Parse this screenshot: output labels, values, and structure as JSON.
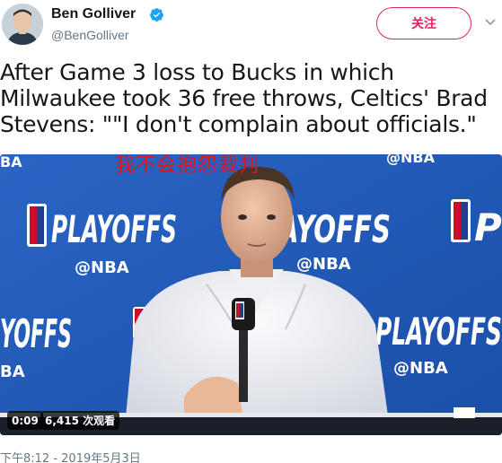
{
  "author": {
    "display_name": "Ben Golliver",
    "handle": "@BenGolliver",
    "verified": true,
    "verified_icon": "verified-badge-icon"
  },
  "follow_label": "关注",
  "tweet": {
    "text": "After Game 3 loss to Bucks in which Milwaukee took 36 free throws, Celtics' Brad Stevens: \"\"I don't complain about officials.\""
  },
  "video": {
    "overlay_caption": "我不会抱怨裁判",
    "backdrop_wordmarks": {
      "playoffs": "PLAYOFFS",
      "partial_left": "YOFFS",
      "nba_tag": "@NBA",
      "partial_nba": "BA"
    },
    "duration": "0:09",
    "views": "6,415 次观看"
  },
  "timestamp": "下午8:12 - 2019年5月3日",
  "colors": {
    "accent": "#e0245e",
    "verified": "#1da1f2",
    "backdrop": "#1f57b8",
    "muted_text": "#657786"
  }
}
